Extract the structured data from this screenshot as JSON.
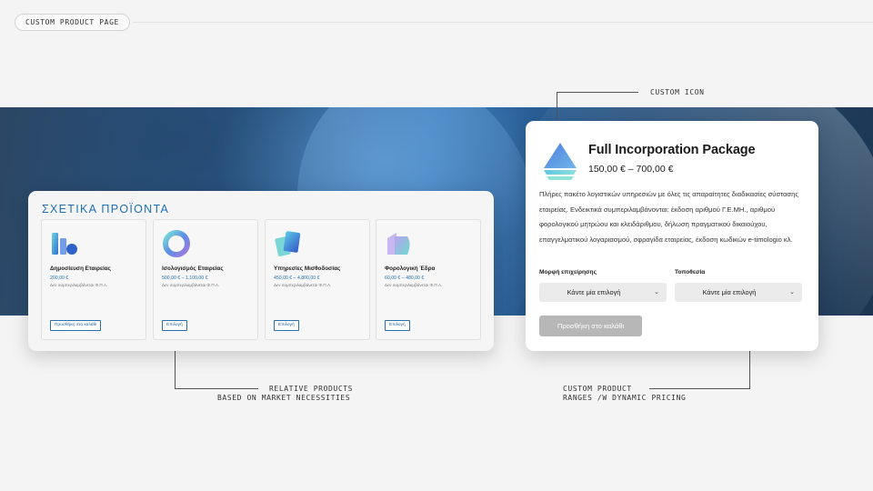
{
  "page_tag": "CUSTOM PRODUCT PAGE",
  "annotations": {
    "custom_icon": "CUSTOM ICON",
    "relative_line1": "RELATIVE PRODUCTS",
    "relative_line2": "BASED ON MARKET NECESSITIES",
    "custom_line1": "CUSTOM PRODUCT",
    "custom_line2": "RANGES /W DYNAMIC PRICING"
  },
  "related": {
    "title": "ΣΧΕΤΙΚΑ ΠΡΟΪΟΝΤΑ",
    "items": [
      {
        "name": "Δημοσίευση Εταιρείας",
        "price": "200,00 €",
        "vat": "Δεν συμπεριλαμβάνεται Φ.Π.Α.",
        "button": "Προσθήκη στο καλάθι",
        "icon": "bars-icon"
      },
      {
        "name": "Ισολογισμός Εταιρείας",
        "price": "500,00 € – 1.100,00 €",
        "vat": "Δεν συμπεριλαμβάνεται Φ.Π.Α.",
        "button": "Επιλογή",
        "icon": "donut-icon"
      },
      {
        "name": "Υπηρεσίες Μισθοδοσίας",
        "price": "450,00 € – 4.800,00 €",
        "vat": "Δεν συμπεριλαμβάνεται Φ.Π.Α.",
        "button": "Επιλογή",
        "icon": "cards-icon"
      },
      {
        "name": "Φορολογική Έδρα",
        "price": "60,00 € – 480,00 €",
        "vat": "Δεν συμπεριλαμβάνεται Φ.Π.Α.",
        "button": "Επιλογή",
        "icon": "building-icon"
      }
    ]
  },
  "product": {
    "title": "Full Incorporation Package",
    "price_range": "150,00 € – 700,00 €",
    "description": "Πλήρες πακέτο λογιστικών υπηρεσιών με όλες τις απαραίτητες διαδικασίες σύστασης εταιρείας. Ενδεικτικά συμπεριλαμβάνονται: έκδοση αριθμού Γ.Ε.ΜΗ., αριθμού φορολογικού μητρώου και κλειδάριθμου, δήλωση πραγματικού δικαιούχου, επαγγελματικού λογαριασμού, σφραγίδα εταιρείας, έκδοση κωδικών e-timologio κλ.",
    "field1_label": "Μορφή επιχείρησης",
    "field1_value": "Κάντε μία επιλογή",
    "field2_label": "Τοποθεσία",
    "field2_value": "Κάντε μία επιλογή",
    "cart_button": "Προσθήκη στο καλάθι"
  },
  "colors": {
    "accent": "#1f6fb5",
    "disabled_button": "#b7b7b7"
  }
}
